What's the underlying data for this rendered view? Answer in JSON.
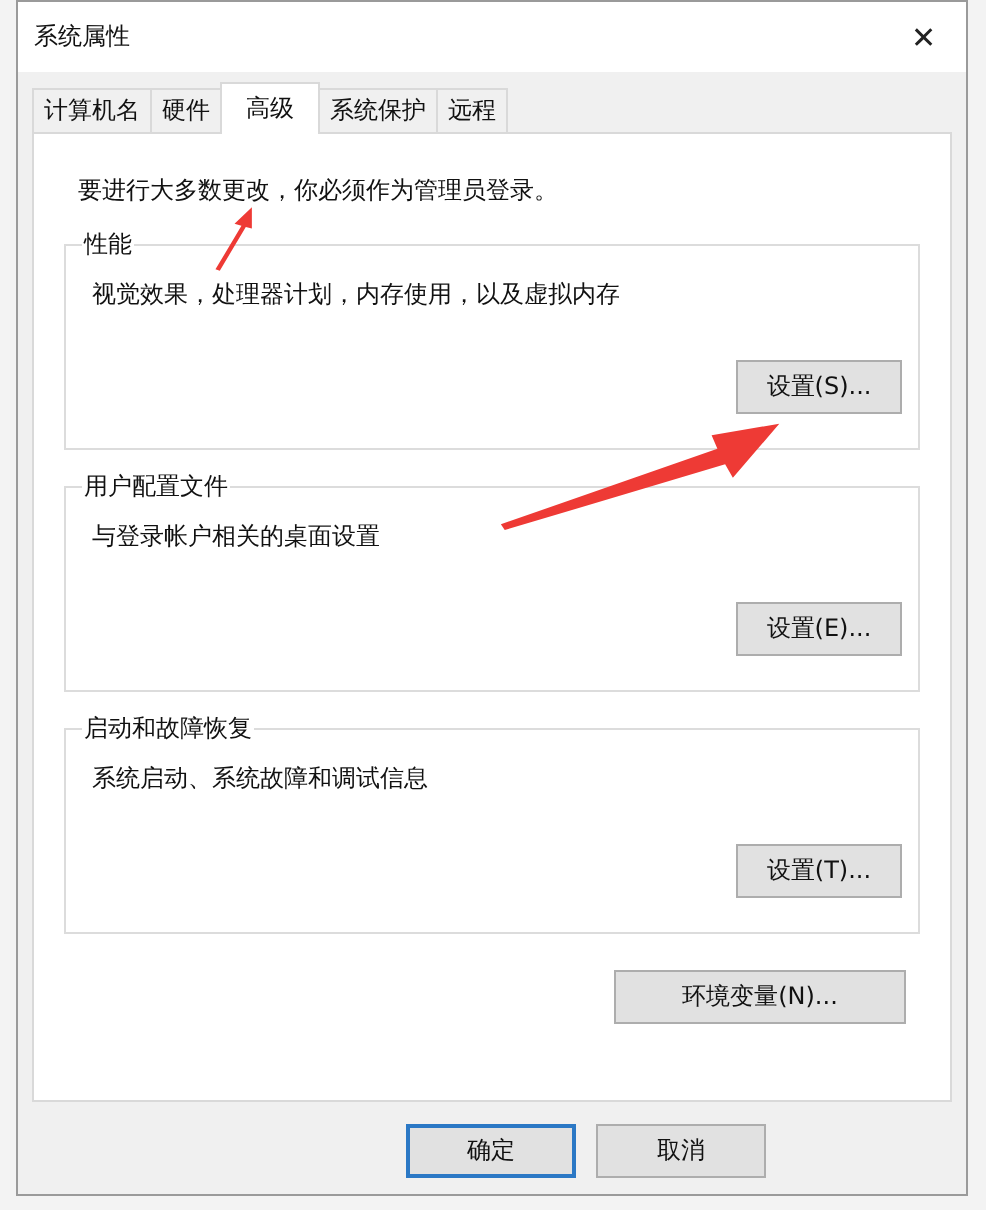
{
  "window": {
    "title": "系统属性",
    "close": "✕"
  },
  "tabs": [
    {
      "label": "计算机名",
      "selected": false
    },
    {
      "label": "硬件",
      "selected": false
    },
    {
      "label": "高级",
      "selected": true
    },
    {
      "label": "系统保护",
      "selected": false
    },
    {
      "label": "远程",
      "selected": false
    }
  ],
  "notice": "要进行大多数更改，你必须作为管理员登录。",
  "groups": [
    {
      "title": "性能",
      "description": "视觉效果，处理器计划，内存使用，以及虚拟内存",
      "button": "设置(S)..."
    },
    {
      "title": "用户配置文件",
      "description": "与登录帐户相关的桌面设置",
      "button": "设置(E)..."
    },
    {
      "title": "启动和故障恢复",
      "description": "系统启动、系统故障和调试信息",
      "button": "设置(T)..."
    }
  ],
  "env_button": "环境变量(N)...",
  "buttons": [
    {
      "label": "确定",
      "default": true
    },
    {
      "label": "取消",
      "default": false
    }
  ]
}
